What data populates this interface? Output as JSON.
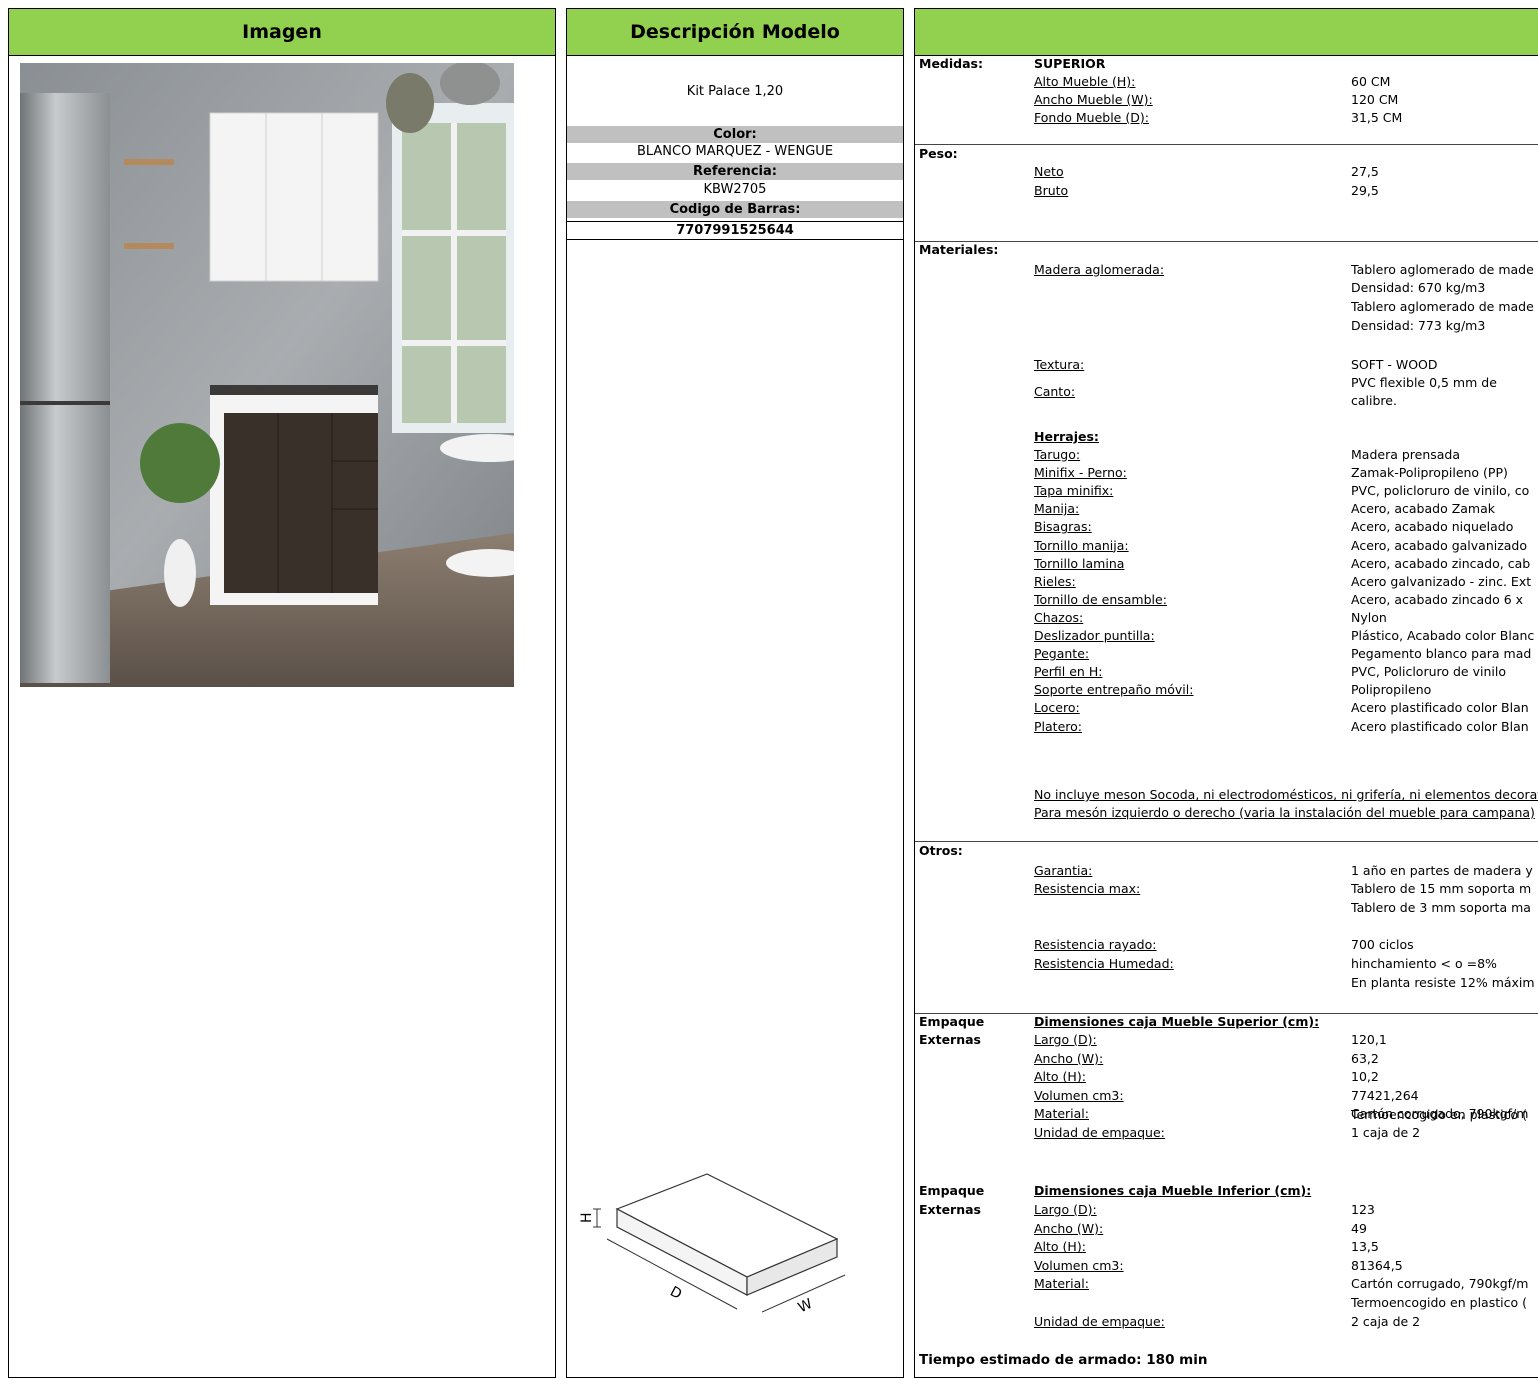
{
  "headers": {
    "image": "Imagen",
    "description": "Descripción Modelo",
    "specs": ""
  },
  "model": {
    "name": "Kit Palace 1,20",
    "color_label": "Color:",
    "color_value": "BLANCO MARQUEZ - WENGUE",
    "reference_label": "Referencia:",
    "reference_value": "KBW2705",
    "barcode_label": "Codigo de Barras:",
    "barcode_value": "7707991525644"
  },
  "box_diagram": {
    "h_label": "H",
    "d_label": "D",
    "w_label": "W"
  },
  "medidas": {
    "label": "Medidas:",
    "subtitle": "SUPERIOR",
    "rows": [
      {
        "label": "Alto Mueble (H):",
        "value": "60 CM"
      },
      {
        "label": "Ancho Mueble (W):",
        "value": "120 CM"
      },
      {
        "label": "Fondo Mueble (D):",
        "value": "31,5 CM"
      }
    ]
  },
  "peso": {
    "label": "Peso:",
    "rows": [
      {
        "label": "Neto",
        "value": "27,5"
      },
      {
        "label": "Bruto",
        "value": "29,5"
      }
    ]
  },
  "materiales": {
    "label": "Materiales:",
    "madera_label": "Madera aglomerada:",
    "madera_lines": [
      "Tablero aglomerado de made",
      "Densidad: 670 kg/m3",
      "Tablero aglomerado de made",
      "Densidad: 773 kg/m3"
    ],
    "textura_label": "Textura:",
    "textura_value": "SOFT - WOOD",
    "canto_label": "Canto:",
    "canto_lines": [
      "PVC flexible 0,5 mm de",
      "calibre."
    ],
    "herrajes_title": "Herrajes:",
    "herrajes": [
      {
        "label": "Tarugo:",
        "value": "Madera prensada"
      },
      {
        "label": "Minifix - Perno:",
        "value": "Zamak-Polipropileno (PP)"
      },
      {
        "label": "Tapa minifix:",
        "value": "PVC, policloruro de vinilo, co"
      },
      {
        "label": "Manija:",
        "value": "Acero, acabado Zamak"
      },
      {
        "label": "Bisagras:",
        "value": "Acero, acabado niquelado"
      },
      {
        "label": "Tornillo manija:",
        "value": "Acero, acabado galvanizado"
      },
      {
        "label": "Tornillo lamina",
        "value": "Acero, acabado zincado, cab"
      },
      {
        "label": "Rieles:",
        "value": "Acero galvanizado - zinc. Ext"
      },
      {
        "label": "Tornillo de ensamble:",
        "value": "Acero, acabado zincado 6 x"
      },
      {
        "label": "Chazos:",
        "value": "Nylon"
      },
      {
        "label": "Deslizador puntilla: ",
        "value": "Plástico, Acabado color Blanc"
      },
      {
        "label": "Pegante:",
        "value": "Pegamento blanco para mad"
      },
      {
        "label": "Perfil en H:",
        "value": "PVC, Policloruro de vinilo"
      },
      {
        "label": "Soporte entrepaño móvil:",
        "value": "Polipropileno"
      },
      {
        "label": "Locero:",
        "value": "Acero plastificado color Blan"
      },
      {
        "label": "Platero:",
        "value": "Acero plastificado color Blan"
      }
    ],
    "note1": "No incluye meson Socoda, ni electrodomésticos, ni grifería, ni elementos decorativ",
    "note2": "Para mesón izquierdo o derecho (varia la instalación del mueble para campana)"
  },
  "otros": {
    "label": "Otros:",
    "garantia_label": "Garantia: ",
    "garantia_value": "1 año en partes de madera y",
    "resistencia_label": "Resistencia max:",
    "resistencia_lines": [
      "Tablero de 15 mm soporta m",
      "Tablero de 3 mm soporta ma"
    ],
    "rayado_label": "Resistencia rayado:",
    "rayado_value": "700 ciclos",
    "humedad_label": "Resistencia Humedad:",
    "humedad_lines": [
      "hinchamiento < o =8%",
      "En planta resiste 12% máxim"
    ]
  },
  "empaque_sup": {
    "label1": "Empaque",
    "label2": "Externas",
    "title": "Dimensiones caja Mueble Superior (cm):",
    "rows": [
      {
        "label": "Largo (D):",
        "value": "120,1"
      },
      {
        "label": "Ancho (W):",
        "value": "63,2"
      },
      {
        "label": "Alto (H): ",
        "value": "10,2"
      },
      {
        "label": "Volumen cm3:",
        "value": "77421,264"
      },
      {
        "label": "Material:",
        "value": "Cartón corrugado, 790kgf/m"
      }
    ],
    "material_extra": "Termoencogido en plastico (",
    "unidad_label": "Unidad de empaque:",
    "unidad_value": "1 caja de 2"
  },
  "empaque_inf": {
    "label1": "Empaque",
    "label2": "Externas",
    "title": "Dimensiones caja Mueble Inferior (cm):",
    "rows": [
      {
        "label": "Largo (D):",
        "value": "123"
      },
      {
        "label": "Ancho (W):",
        "value": "49"
      },
      {
        "label": "Alto (H): ",
        "value": "13,5"
      },
      {
        "label": "Volumen cm3:",
        "value": "81364,5"
      },
      {
        "label": "Material:",
        "value": "Cartón corrugado, 790kgf/m"
      }
    ],
    "material_extra": "Termoencogido en plastico (",
    "unidad_label": "Unidad de empaque:",
    "unidad_value": "2 caja de 2"
  },
  "tiempo": "Tiempo estimado de armado: 180 min"
}
